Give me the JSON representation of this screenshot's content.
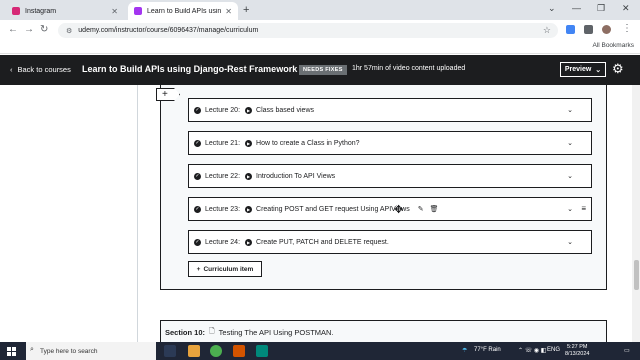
{
  "browser": {
    "tabs": [
      {
        "label": "Instagram",
        "active": false,
        "favicon_color": "#d62976"
      },
      {
        "label": "Learn to Build APIs using Djang…",
        "active": true,
        "favicon_color": "#a435f0"
      }
    ],
    "new_tab": "+",
    "url": "udemy.com/instructor/course/6096437/manage/curriculum",
    "all_bookmarks": "All Bookmarks",
    "window_controls": {
      "minimize": "⌄",
      "min": "—",
      "restore": "❐",
      "close": "✕"
    }
  },
  "header": {
    "back_label": "Back to courses",
    "course_title": "Learn to Build APIs using Django-Rest Framework",
    "status_badge": "NEEDS FIXES",
    "uploaded_text": "1hr 57min of video content uploaded",
    "preview_label": "Preview",
    "colors": {
      "bg": "#1c1d1f",
      "badge_bg": "#6a6f73"
    }
  },
  "curriculum": {
    "add_symbol": "+",
    "lectures": [
      {
        "number": "Lecture 20:",
        "title": "Class based views"
      },
      {
        "number": "Lecture 21:",
        "title": "How to create a Class in Python?"
      },
      {
        "number": "Lecture 22:",
        "title": "Introduction To API Views"
      },
      {
        "number": "Lecture 23:",
        "title": "Creating POST and GET request Using APIViews"
      },
      {
        "number": "Lecture 24:",
        "title": "Create PUT, PATCH and DELETE request."
      }
    ],
    "curriculum_item_label": "Curriculum item",
    "next_section": {
      "label": "Section 10:",
      "title": "Testing The API Using POSTMAN."
    }
  },
  "taskbar": {
    "search_placeholder": "Type here to search",
    "weather": "77°F  Rain",
    "language": "ENG",
    "time": "5:27 PM",
    "date": "8/13/2024"
  }
}
